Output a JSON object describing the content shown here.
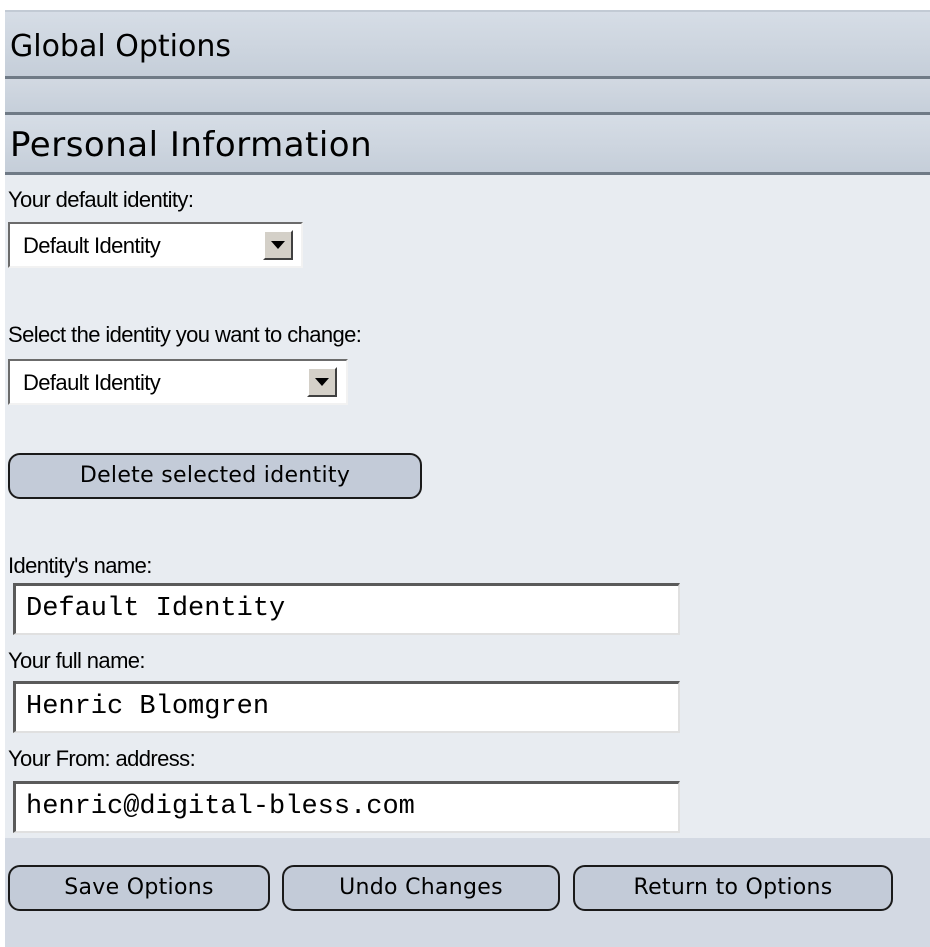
{
  "global_header": {
    "title": "Global Options"
  },
  "personal_header": {
    "title": "Personal Information"
  },
  "default_identity": {
    "label": "Your default identity:",
    "selected": "Default Identity"
  },
  "change_identity": {
    "label": "Select the identity you want to change:",
    "selected": "Default Identity"
  },
  "delete_button": {
    "label": "Delete selected identity"
  },
  "identity_name": {
    "label": "Identity's name:",
    "value": "Default Identity"
  },
  "full_name": {
    "label": "Your full name:",
    "value": "Henric Blomgren"
  },
  "from_address": {
    "label": "Your From: address:",
    "value": "henric@digital-bless.com"
  },
  "actions": {
    "save": "Save Options",
    "undo": "Undo Changes",
    "return": "Return to Options"
  }
}
